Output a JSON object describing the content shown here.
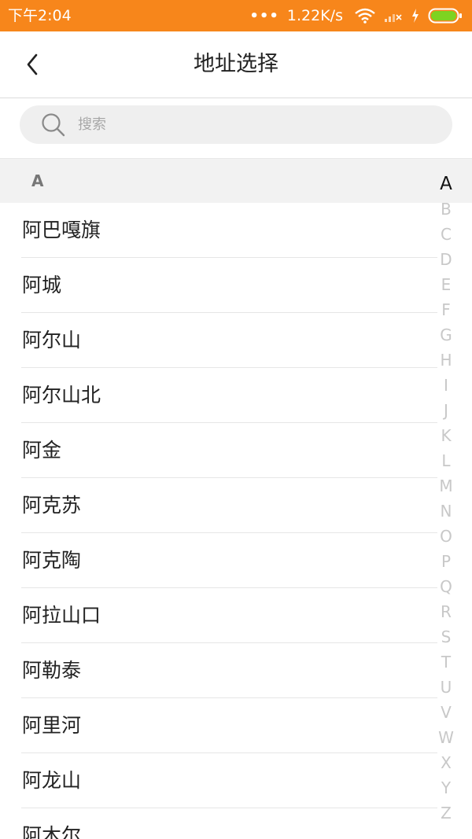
{
  "status_bar": {
    "time": "下午2:04",
    "dots": "•••",
    "network_speed": "1.22K/s",
    "background_color": "#f7861b",
    "battery_color": "#7ed321",
    "icons": [
      "wifi-icon",
      "signal-icon",
      "charging-icon",
      "battery-icon"
    ]
  },
  "header": {
    "title": "地址选择",
    "back_icon": "chevron-left-icon"
  },
  "search": {
    "placeholder": "搜索",
    "value": "",
    "icon": "search-icon"
  },
  "section": {
    "letter": "A"
  },
  "cities": [
    {
      "name": "阿巴嘎旗"
    },
    {
      "name": "阿城"
    },
    {
      "name": "阿尔山"
    },
    {
      "name": "阿尔山北"
    },
    {
      "name": "阿金"
    },
    {
      "name": "阿克苏"
    },
    {
      "name": "阿克陶"
    },
    {
      "name": "阿拉山口"
    },
    {
      "name": "阿勒泰"
    },
    {
      "name": "阿里河"
    },
    {
      "name": "阿龙山"
    },
    {
      "name": "阿木尔"
    }
  ],
  "index_letters": [
    "A",
    "B",
    "C",
    "D",
    "E",
    "F",
    "G",
    "H",
    "I",
    "J",
    "K",
    "L",
    "M",
    "N",
    "O",
    "P",
    "Q",
    "R",
    "S",
    "T",
    "U",
    "V",
    "W",
    "X",
    "Y",
    "Z"
  ],
  "active_index_letter": "A"
}
